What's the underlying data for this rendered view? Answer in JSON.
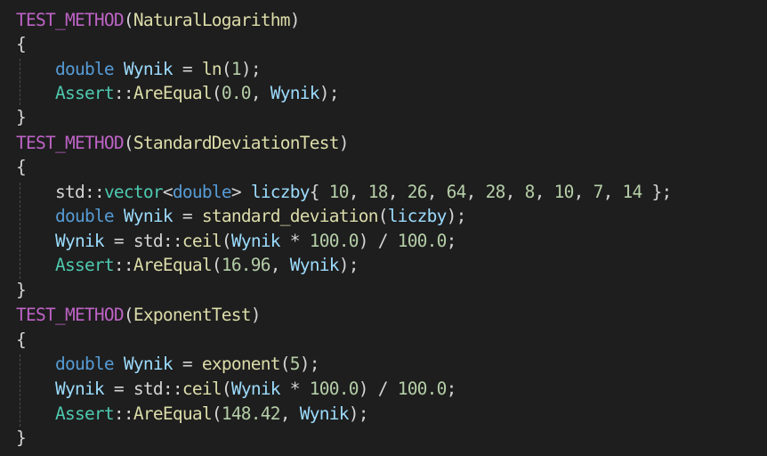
{
  "colors": {
    "background": "#1e1e1e",
    "macro": "#bd63c5",
    "function": "#dcdcaa",
    "keyword": "#569cd6",
    "variable": "#9cdcfe",
    "type": "#4ec9b0",
    "number": "#b5cea8",
    "punctuation": "#d4d4d4"
  },
  "code": {
    "test1": {
      "macro": "TEST_METHOD",
      "name": "NaturalLogarithm",
      "l1_kw": "double",
      "l1_var": "Wynik",
      "l1_eq": " = ",
      "l1_fn": "ln",
      "l1_num": "1",
      "l2_type": "Assert",
      "l2_fn": "AreEqual",
      "l2_num": "0.0",
      "l2_var": "Wynik"
    },
    "test2": {
      "macro": "TEST_METHOD",
      "name": "StandardDeviationTest",
      "l1_ns": "std",
      "l1_type": "vector",
      "l1_kw": "double",
      "l1_var": "liczby",
      "l1_nums": [
        "10",
        "18",
        "26",
        "64",
        "28",
        "8",
        "10",
        "7",
        "14"
      ],
      "l2_kw": "double",
      "l2_var": "Wynik",
      "l2_fn": "standard_deviation",
      "l2_arg": "liczby",
      "l3_var": "Wynik",
      "l3_ns": "std",
      "l3_fn": "ceil",
      "l3_arg": "Wynik",
      "l3_num1": "100.0",
      "l3_num2": "100.0",
      "l4_type": "Assert",
      "l4_fn": "AreEqual",
      "l4_num": "16.96",
      "l4_var": "Wynik"
    },
    "test3": {
      "macro": "TEST_METHOD",
      "name": "ExponentTest",
      "l1_kw": "double",
      "l1_var": "Wynik",
      "l1_fn": "exponent",
      "l1_num": "5",
      "l2_var": "Wynik",
      "l2_ns": "std",
      "l2_fn": "ceil",
      "l2_arg": "Wynik",
      "l2_num1": "100.0",
      "l2_num2": "100.0",
      "l3_type": "Assert",
      "l3_fn": "AreEqual",
      "l3_num": "148.42",
      "l3_var": "Wynik"
    }
  }
}
